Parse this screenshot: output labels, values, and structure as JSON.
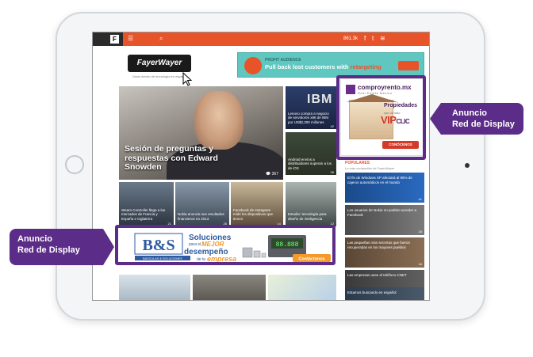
{
  "site": {
    "logo_text": "FayerWayer",
    "logo_tagline": "Úsalo dentro de tecnología en español",
    "topbar_stats": "861.3k",
    "topbar_menu_icon": "menu-icon",
    "topbar_search_icon": "search-icon"
  },
  "top_ad": {
    "eyebrow": "PROFIT AUDIENCE",
    "headline_start": "Pull back lost customers with",
    "headline_emphasis": "retargeting"
  },
  "hero": {
    "title": "Sesión de preguntas y respuestas con Edward Snowden",
    "comments": "367"
  },
  "side_stories": [
    {
      "caption": "Lenovo compra a negocio de servidores x86 de IBM por US$2,300 millones",
      "comments": "42",
      "logo": "IBM"
    },
    {
      "caption": "Android envíos a distribuidores superan a los de iOS",
      "comments": "36"
    }
  ],
  "grid_stories": [
    {
      "caption": "Steam Controller llega a los mercados de Francia y España e Inglaterra",
      "comments": "21"
    },
    {
      "caption": "Nokia anuncia sus resultados financieros en 2013",
      "comments": "26"
    },
    {
      "caption": "Facebook de Instagram mide los dispositivos que tienen",
      "comments": "14"
    },
    {
      "caption": "Estudio: tecnología para diseño de inteligencia",
      "comments": "12"
    }
  ],
  "sidebar_ad": {
    "brand": "comproyrento.mx",
    "brand_sub": "Real Estate México",
    "title": "Propiedades",
    "subtitle": "con un sólo",
    "vip": "VIP",
    "clic": "CLIC",
    "cta": "CONÓCENOS"
  },
  "popular": {
    "heading": "POPULARES",
    "subheading": "Lo más compartido de FayerWayer",
    "items": [
      {
        "caption": "El fin de Windows XP afectará al 95% de cajeros automáticos en el mundo",
        "comments": "41"
      },
      {
        "caption": "Los usuarios de Nokia no podrán acceder a Facebook",
        "comments": "28"
      },
      {
        "caption": "Las pequeñas más secretas que fueron recuperadas en los mayores pueblos",
        "comments": "18"
      },
      {
        "caption": "Las empresas usan el teléfono CNET",
        "comments": "15"
      },
      {
        "caption": "Estamos buscando en español",
        "comments": "9"
      }
    ]
  },
  "banner_ad": {
    "brand": "B&S",
    "brand_sub": "BÁSCULAS & SOLUCIONES",
    "line1": "Soluciones",
    "line2_pre": "para el",
    "line2_emph": "MEJOR",
    "line3": "desempeño",
    "line4_pre": "de tu",
    "line4_emph": "empresa",
    "cta": "Contáctanos",
    "display_reading": "88.888"
  },
  "callouts": {
    "left_line1": "Anuncio",
    "left_line2": "Red de Display",
    "right_line1": "Anuncio",
    "right_line2": "Red de Display"
  },
  "colors": {
    "accent": "#e8542a",
    "highlight": "#5c2d88",
    "top_ad_bg": "#5fc7c0",
    "banner_orange": "#f59a2a",
    "banner_blue": "#2d5aa0"
  }
}
